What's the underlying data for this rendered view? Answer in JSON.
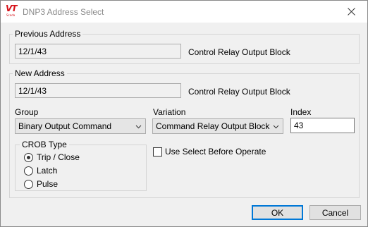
{
  "window": {
    "title": "DNP3 Address Select",
    "logo_text": "VT",
    "logo_subtext": "Scada",
    "close_icon": "close-icon"
  },
  "previous_address": {
    "legend": "Previous Address",
    "value": "12/1/43",
    "type_label": "Control Relay Output Block"
  },
  "new_address": {
    "legend": "New Address",
    "value": "12/1/43",
    "type_label": "Control Relay Output Block",
    "group_label": "Group",
    "group_value": "Binary Output Command",
    "variation_label": "Variation",
    "variation_value": "Command Relay Output Block",
    "index_label": "Index",
    "index_value": "43"
  },
  "crob_type": {
    "legend": "CROB Type",
    "options": [
      {
        "label": "Trip / Close",
        "checked": true
      },
      {
        "label": "Latch",
        "checked": false
      },
      {
        "label": "Pulse",
        "checked": false
      }
    ]
  },
  "use_sbo": {
    "label": "Use Select Before Operate",
    "checked": false
  },
  "buttons": {
    "ok": "OK",
    "cancel": "Cancel"
  },
  "colors": {
    "accent": "#0078d7",
    "logo": "#d6121a",
    "dialog_bg": "#f0f0f0"
  }
}
